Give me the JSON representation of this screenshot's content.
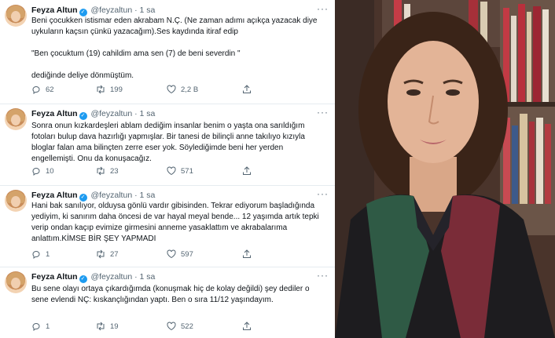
{
  "tweets": [
    {
      "name": "Feyza Altun",
      "handle": "@feyzaltun",
      "time": "· 1 sa",
      "text": "Beni çocukken istismar eden akrabam  N.Ç.  (Ne zaman adımı açıkça yazacak diye uykuların kaçsın çünkü yazacağım).Ses kaydında itiraf edip\n\n  \"Ben çocuktum (19) cahildim ama sen (7) de beni severdin \"\n\ndediğinde deliye dönmüştüm.",
      "replies": "62",
      "retweets": "199",
      "likes": "2,2 B"
    },
    {
      "name": "Feyza Altun",
      "handle": "@feyzaltun",
      "time": "· 1 sa",
      "text": "Sonra onun kızkardeşleri ablam dediğim insanlar benim o yaşta ona sarıldığım fotoları bulup dava hazırlığı yapmışlar. Bir tanesi de bilinçli anne takılıyo kızıyla bloglar falan ama bilinçten zerre eser yok. Söylediğimde beni her yerden engellemişti. Onu da konuşacağız.",
      "replies": "10",
      "retweets": "23",
      "likes": "571"
    },
    {
      "name": "Feyza Altun",
      "handle": "@feyzaltun",
      "time": "· 1 sa",
      "text": "Hani bak sanılıyor, olduysa gönlü vardır gibisinden. Tekrar ediyorum başladığında yediyim, ki sanırım daha öncesi de var hayal meyal bende... 12 yaşımda artık tepki verip ondan kaçıp evimize girmesini anneme yasaklattım ve akrabalarıma anlattım.KİMSE BİR ŞEY YAPMADI",
      "replies": "1",
      "retweets": "27",
      "likes": "597"
    },
    {
      "name": "Feyza Altun",
      "handle": "@feyzaltun",
      "time": "· 1 sa",
      "text": "Bu sene olayı ortaya çıkardığımda (konuşmak hiç de kolay değildi) şey dediler o sene evlendi NÇ: kıskançlığından yaptı. Ben o sıra 11/12 yaşındayım.",
      "replies": "1",
      "retweets": "19",
      "likes": "522"
    }
  ],
  "icons": {
    "reply": "reply-icon",
    "retweet": "retweet-icon",
    "like": "heart-icon",
    "share": "share-icon",
    "more": "more-icon"
  },
  "colors": {
    "verified": "#1d9bf0",
    "muted": "#536471"
  }
}
